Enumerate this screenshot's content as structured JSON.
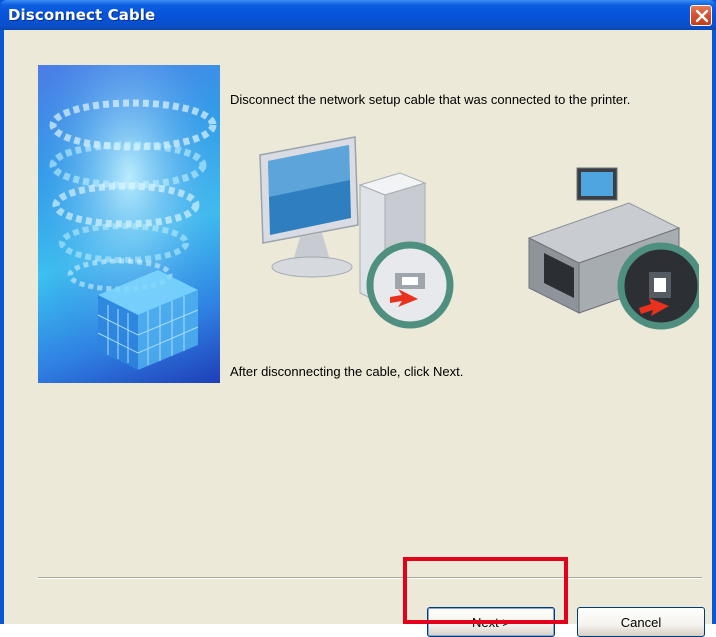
{
  "window": {
    "title": "Disconnect Cable"
  },
  "content": {
    "instruction": "Disconnect the network setup cable that was connected to the printer.",
    "after": "After disconnecting the cable, click Next."
  },
  "buttons": {
    "next_label": "Next >",
    "cancel_label": "Cancel"
  },
  "icons": {
    "close": "close-icon",
    "computer": "computer-icon",
    "printer": "printer-icon",
    "arrow": "red-arrow-icon"
  },
  "colors": {
    "titlebar": "#0652d8",
    "client_bg": "#ece9d8",
    "highlight": "#e2001a",
    "close_button": "#d8522f",
    "arrow": "#e8321e",
    "zoom_ring": "#4f8f80"
  }
}
